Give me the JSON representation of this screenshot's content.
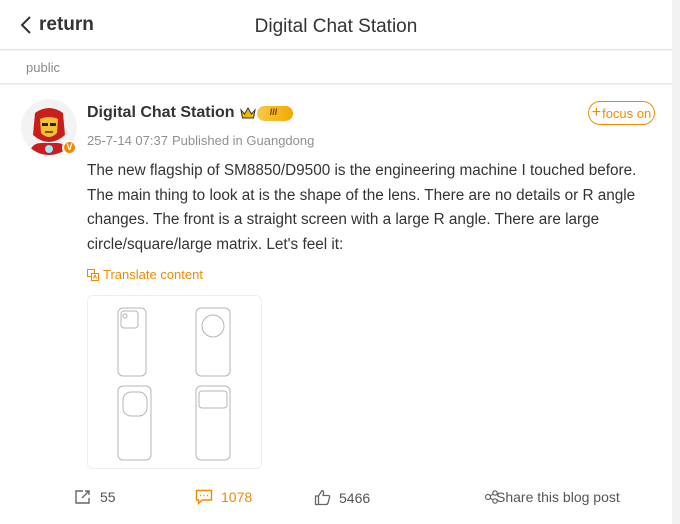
{
  "header": {
    "back_label": "return",
    "title": "Digital Chat Station"
  },
  "visibility": "public",
  "post": {
    "author": "Digital Chat Station",
    "level": "III",
    "verified_badge": "V",
    "date": "25-7-14 07:37",
    "location": "Published in Guangdong",
    "follow_label": "focus on",
    "follow_plus": "+",
    "text": "The new flagship of SM8850/D9500 is the engineering machine I touched before. The main thing to look at is the shape of the lens. There are no details or R angle changes. The front is a straight screen with a large R angle. There are large circle/square/large matrix. Let's feel it:",
    "translate_label": "Translate content"
  },
  "actions": {
    "repost_count": "55",
    "comment_count": "1078",
    "like_count": "5466",
    "share_label": "Share this blog post"
  },
  "colors": {
    "accent": "#f08a00",
    "text": "#333333",
    "muted": "#909090"
  },
  "icons": [
    "back-chevron-icon",
    "crown-icon",
    "translate-icon",
    "repost-icon",
    "comment-icon",
    "like-icon",
    "share-icon"
  ]
}
